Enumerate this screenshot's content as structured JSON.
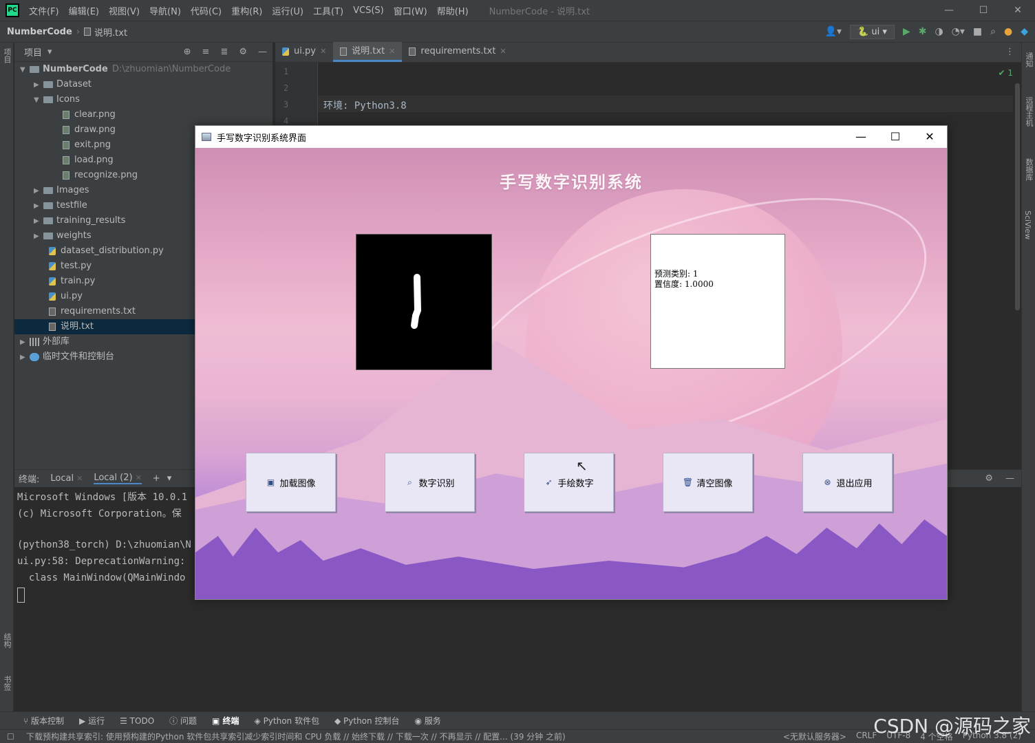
{
  "ide": {
    "logo": "PC",
    "menu": [
      "文件(F)",
      "编辑(E)",
      "视图(V)",
      "导航(N)",
      "代码(C)",
      "重构(R)",
      "运行(U)",
      "工具(T)",
      "VCS(S)",
      "窗口(W)",
      "帮助(H)"
    ],
    "title": "NumberCode - 说明.txt",
    "nav": {
      "project": "NumberCode",
      "file": "说明.txt",
      "run_config": "ui"
    },
    "project_panel": {
      "title": "项目",
      "root": "NumberCode",
      "root_path": "D:\\zhuomian\\NumberCode",
      "items": [
        {
          "label": "Dataset",
          "type": "folder"
        },
        {
          "label": "Icons",
          "type": "folder"
        },
        {
          "label": "clear.png",
          "type": "png"
        },
        {
          "label": "draw.png",
          "type": "png"
        },
        {
          "label": "exit.png",
          "type": "png"
        },
        {
          "label": "load.png",
          "type": "png"
        },
        {
          "label": "recognize.png",
          "type": "png"
        },
        {
          "label": "Images",
          "type": "folder"
        },
        {
          "label": "testfile",
          "type": "folder"
        },
        {
          "label": "training_results",
          "type": "folder"
        },
        {
          "label": "weights",
          "type": "folder"
        },
        {
          "label": "dataset_distribution.py",
          "type": "py"
        },
        {
          "label": "test.py",
          "type": "py"
        },
        {
          "label": "train.py",
          "type": "py"
        },
        {
          "label": "ui.py",
          "type": "py"
        },
        {
          "label": "requirements.txt",
          "type": "txt"
        },
        {
          "label": "说明.txt",
          "type": "txt"
        }
      ],
      "external_libs": "外部库",
      "scratches": "临时文件和控制台"
    },
    "left_strip": [
      "项目",
      "结构",
      "书签"
    ],
    "right_strip": [
      "通知",
      "远程主机",
      "数据库",
      "SciView"
    ],
    "editor": {
      "tabs": [
        "ui.py",
        "说明.txt",
        "requirements.txt"
      ],
      "active_tab": "说明.txt",
      "line_numbers": [
        "1",
        "2",
        "3",
        "4"
      ],
      "line3": "环境:  Python3.8",
      "inspection": "✔ 1"
    },
    "terminal": {
      "label": "终端:",
      "tabs": [
        "Local",
        "Local (2)"
      ],
      "lines": [
        "Microsoft Windows [版本 10.0.1",
        "(c) Microsoft Corporation。保",
        "",
        "(python38_torch) D:\\zhuomian\\N",
        "ui.py:58: DeprecationWarning:",
        "  class MainWindow(QMainWindo"
      ]
    },
    "bottom_tools": [
      "版本控制",
      "运行",
      "TODO",
      "问题",
      "终端",
      "Python 软件包",
      "Python 控制台",
      "服务"
    ],
    "active_bottom_tool": "终端",
    "status_message": "下载预构建共享索引: 使用预构建的Python 软件包共享索引减少索引时间和 CPU 负载 // 始终下载 // 下载一次 // 不再显示 // 配置... (39 分钟 之前)",
    "status_right": [
      "<无默认服务器>",
      "CRLF",
      "UTF-8",
      "4 个空格",
      "Python 3.8 (2)"
    ]
  },
  "app_window": {
    "title": "手写数字识别系统界面",
    "heading": "手写数字识别系统",
    "result": {
      "line1": "预测类别: 1",
      "line2": "置信度: 1.0000"
    },
    "buttons": [
      {
        "label": "加载图像",
        "icon": "image-icon"
      },
      {
        "label": "数字识别",
        "icon": "search-icon"
      },
      {
        "label": "手绘数字",
        "icon": "pen-cursor-icon"
      },
      {
        "label": "清空图像",
        "icon": "trash-icon"
      },
      {
        "label": "退出应用",
        "icon": "close-circle-icon"
      }
    ]
  },
  "watermark": "CSDN @源码之家"
}
